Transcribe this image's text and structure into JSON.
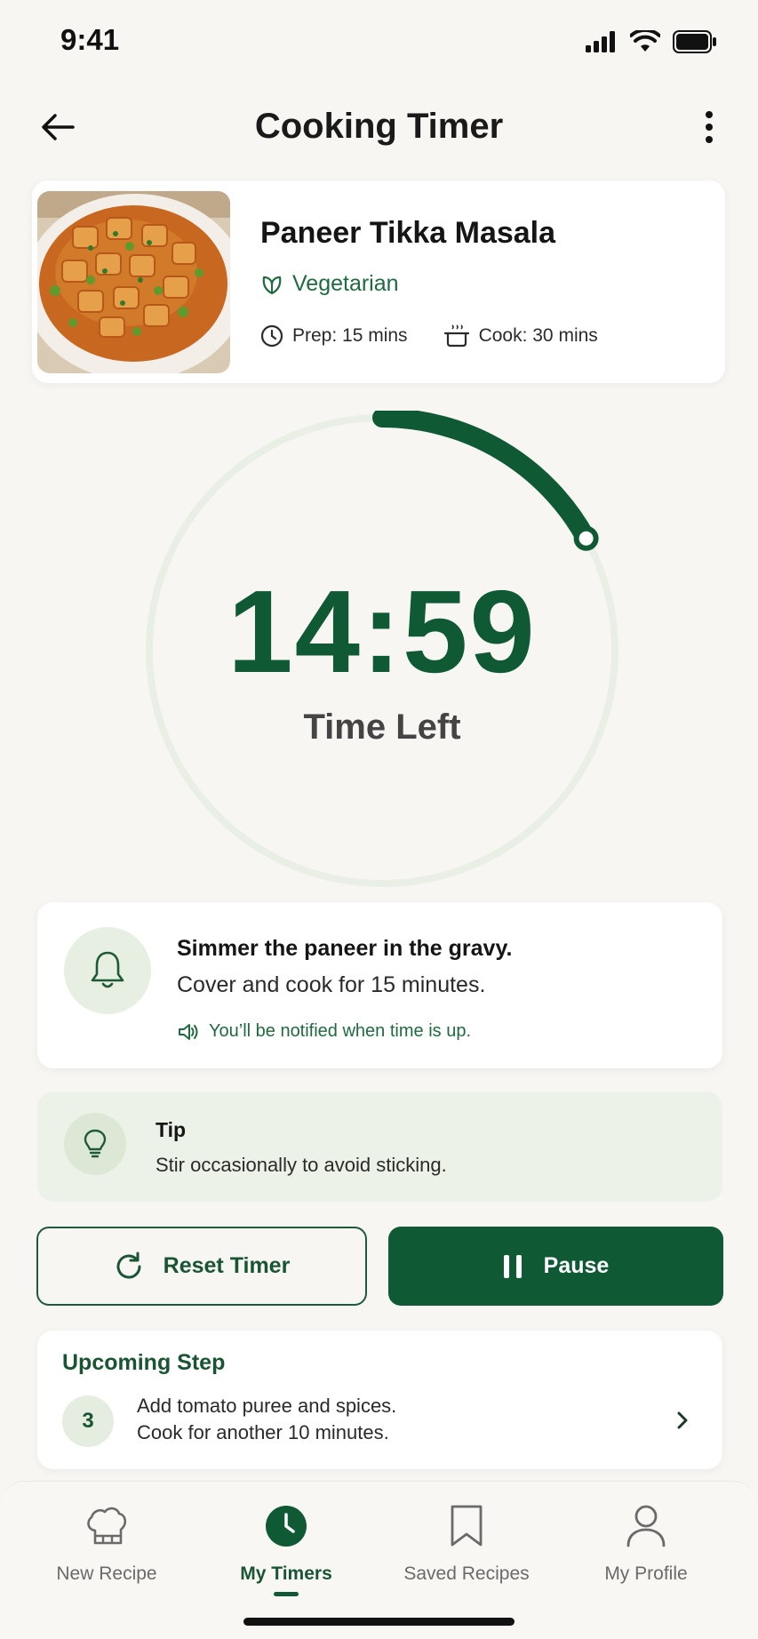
{
  "status_bar": {
    "time": "9:41"
  },
  "header": {
    "title": "Cooking Timer"
  },
  "recipe": {
    "name": "Paneer Tikka Masala",
    "diet": "Vegetarian",
    "prep": "Prep: 15 mins",
    "cook": "Cook: 30 mins"
  },
  "timer": {
    "value": "14:59",
    "label": "Time Left",
    "progress_fraction": 0.17
  },
  "current_step": {
    "title": "Simmer the paneer in the gravy.",
    "description": "Cover and cook for 15 minutes.",
    "notification": "You’ll be notified when time is up."
  },
  "tip": {
    "title": "Tip",
    "text": "Stir occasionally to avoid sticking."
  },
  "actions": {
    "reset_label": "Reset Timer",
    "pause_label": "Pause"
  },
  "upcoming": {
    "title": "Upcoming Step",
    "step_number": "3",
    "line1": "Add tomato puree and spices.",
    "line2": "Cook for another 10 minutes."
  },
  "tabs": [
    {
      "label": "New Recipe",
      "icon": "chef-hat-icon"
    },
    {
      "label": "My Timers",
      "icon": "clock-icon",
      "active": true
    },
    {
      "label": "Saved Recipes",
      "icon": "bookmark-icon"
    },
    {
      "label": "My Profile",
      "icon": "user-icon"
    }
  ],
  "colors": {
    "primary": "#0f5a34",
    "track": "#eaefe5",
    "tip_bg": "#ecf2e7"
  }
}
